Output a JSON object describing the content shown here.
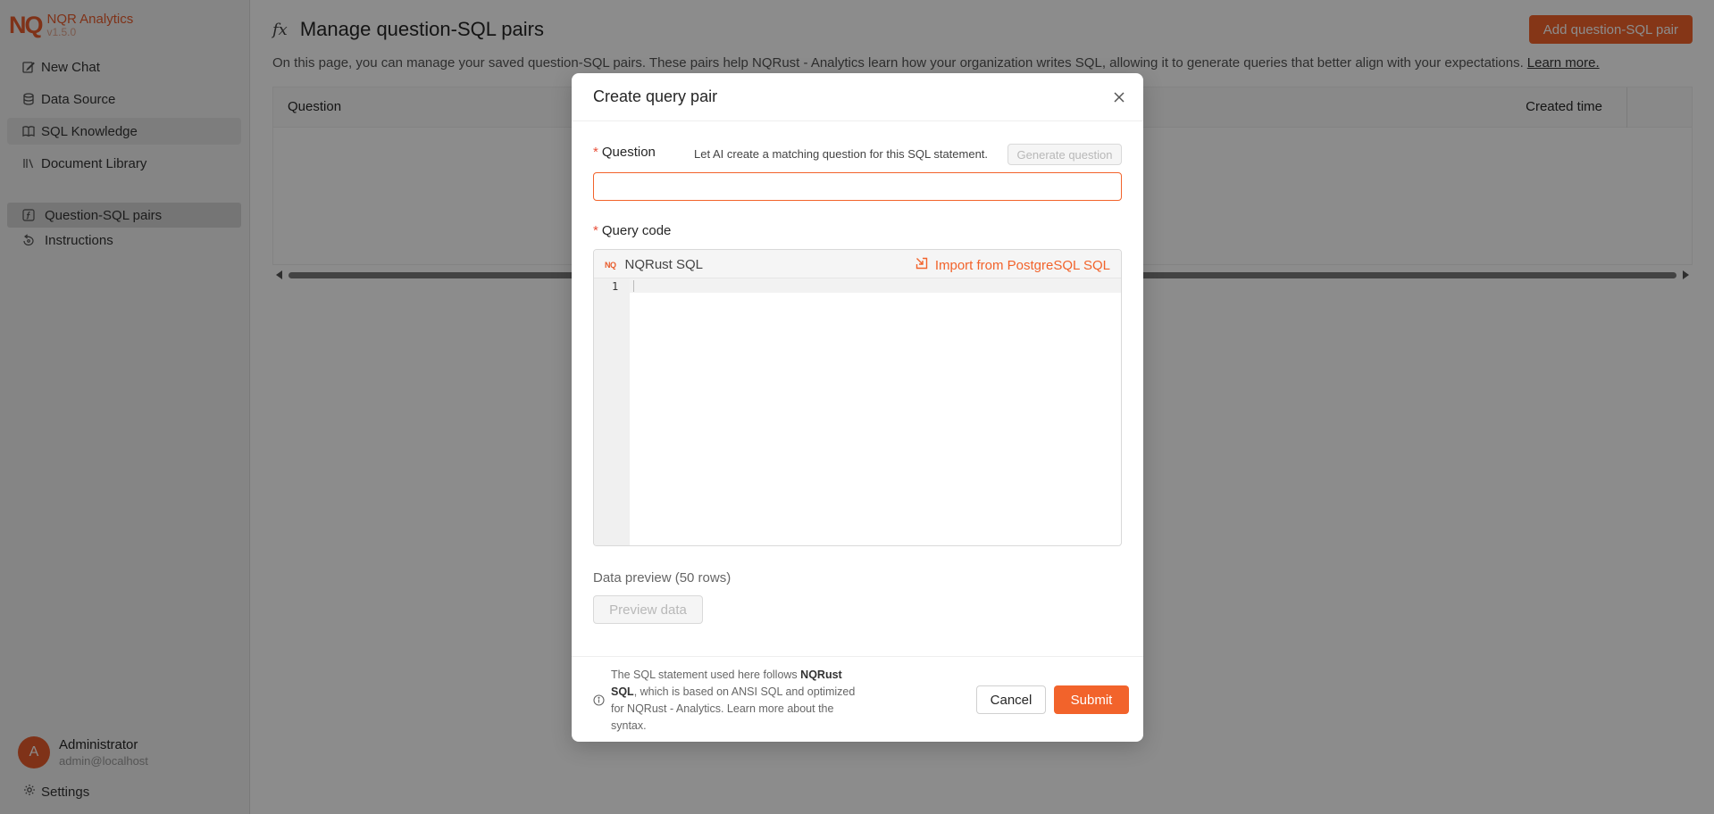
{
  "app": {
    "logo_mark": "NQ",
    "name": "NQR Analytics",
    "version": "v1.5.0",
    "brand_color": "#e85c2c"
  },
  "sidebar": {
    "items": [
      {
        "label": "New Chat",
        "icon": "edit-icon"
      },
      {
        "label": "Data Source",
        "icon": "database-icon"
      },
      {
        "label": "SQL Knowledge",
        "icon": "book-icon",
        "active": true
      },
      {
        "label": "Document Library",
        "icon": "library-icon"
      }
    ],
    "sub_items": [
      {
        "label": "Question-SQL pairs",
        "icon": "function-icon",
        "active": true
      },
      {
        "label": "Instructions",
        "icon": "instructions-icon"
      }
    ],
    "user": {
      "initial": "A",
      "name": "Administrator",
      "email": "admin@localhost"
    },
    "settings_label": "Settings"
  },
  "main": {
    "title_icon": "fx",
    "title": "Manage question-SQL pairs",
    "add_button": "Add question-SQL pair",
    "description": "On this page, you can manage your saved question-SQL pairs. These pairs help NQRust - Analytics learn how your organization writes SQL, allowing it to generate queries that better align with your expectations.",
    "learn_more": "Learn more.",
    "table": {
      "columns": [
        "Question",
        "Created time"
      ]
    }
  },
  "modal": {
    "title": "Create query pair",
    "question_label": "Question",
    "ai_hint": "Let AI create a matching question for this SQL statement.",
    "generate_button": "Generate question",
    "question_value": "",
    "query_label": "Query code",
    "dialect_logo": "NQ",
    "dialect": "NQRust SQL",
    "import_button": "Import from PostgreSQL SQL",
    "line_number": "1",
    "preview_label": "Data preview (50 rows)",
    "preview_button": "Preview data",
    "footnote_pre": "The SQL statement used here follows",
    "footnote_bold": "NQRust SQL",
    "footnote_mid": ", which is based on ANSI SQL and optimized for NQRust - Analytics.",
    "footnote_link": "Learn more about the syntax.",
    "cancel_button": "Cancel",
    "submit_button": "Submit",
    "accent_color": "#f2632b"
  }
}
